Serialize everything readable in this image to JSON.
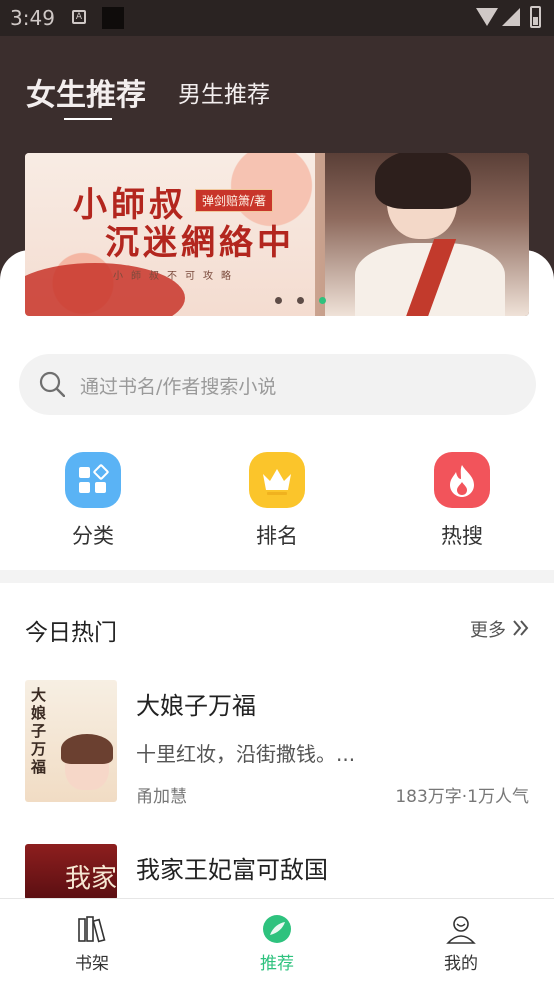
{
  "status_bar": {
    "time": "3:49",
    "notification_letter": "A"
  },
  "tabs": [
    {
      "label": "女生推荐",
      "active": true
    },
    {
      "label": "男生推荐",
      "active": false
    }
  ],
  "banner": {
    "title_line1": "小師叔",
    "title_line2": "沉迷網絡中",
    "author_tag": "弹剑赔箫/著",
    "subtitle": "小師叔不可攻略",
    "dots": 3,
    "active_dot": 2
  },
  "search": {
    "placeholder": "通过书名/作者搜索小说",
    "icon": "search-icon"
  },
  "entries": [
    {
      "label": "分类",
      "icon": "category-icon",
      "color": "#5ab3f5"
    },
    {
      "label": "排名",
      "icon": "crown-icon",
      "color": "#fbc52b"
    },
    {
      "label": "热搜",
      "icon": "flame-icon",
      "color": "#f2545b"
    }
  ],
  "hot_today": {
    "title": "今日热门",
    "more_label": "更多",
    "books": [
      {
        "title": "大娘子万福",
        "cover_text": "大娘子万福",
        "description": "十里红妆，沿街撒钱。...",
        "author": "甬加慧",
        "stats": "183万字·1万人气"
      },
      {
        "title": "我家王妃富可敌国",
        "cover_text": "我家",
        "description": "",
        "author": "",
        "stats": ""
      }
    ]
  },
  "bottom_nav": [
    {
      "label": "书架",
      "icon": "bookshelf-icon",
      "active": false
    },
    {
      "label": "推荐",
      "icon": "recommend-icon",
      "active": true
    },
    {
      "label": "我的",
      "icon": "profile-icon",
      "active": false
    }
  ],
  "colors": {
    "accent": "#2ec27e",
    "header_bg": "#3b2e2d"
  }
}
